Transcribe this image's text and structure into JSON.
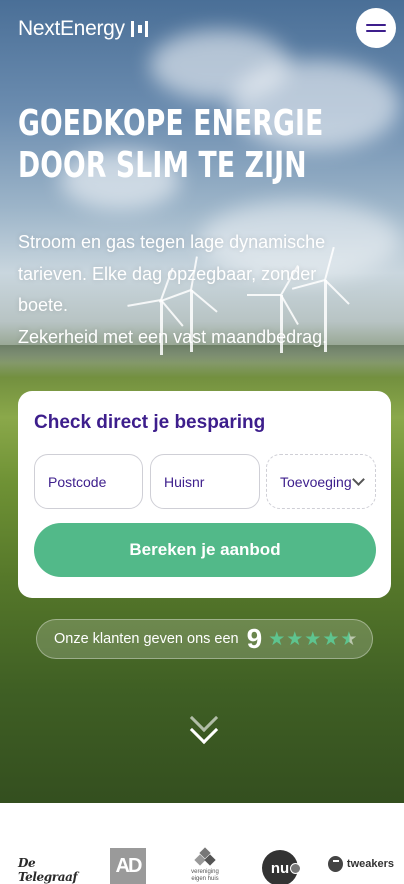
{
  "header": {
    "brand": "NextEnergy",
    "logo_mark_icon": "bars-logo-icon",
    "menu_icon": "hamburger-menu-icon"
  },
  "hero": {
    "headline_line1": "GOEDKOPE ENERGIE",
    "headline_line2": "DOOR SLIM TE ZIJN",
    "sub_lines": [
      "Stroom en gas tegen lage dynamische",
      "tarieven. Elke dag opzegbaar, zonder",
      "boete.",
      "Zekerheid met een vast maandbedrag."
    ]
  },
  "check_form": {
    "title": "Check direct je besparing",
    "postcode_placeholder": "Postcode",
    "huisnr_placeholder": "Huisnr",
    "toevoeging_placeholder": "Toevoeging",
    "submit_label": "Bereken je aanbod"
  },
  "rating": {
    "text": "Onze klanten geven ons een",
    "score": "9",
    "stars": 4.5,
    "star_color": "#5ec48f"
  },
  "press": {
    "logos": {
      "telegraaf": "De Telegraaf",
      "ad": "AD",
      "veh": "vereniging eigen huis",
      "nu": "nu",
      "tweakers": "tweakers"
    }
  },
  "colors": {
    "brand_purple": "#3d1e8c",
    "cta_green": "#52b989"
  }
}
